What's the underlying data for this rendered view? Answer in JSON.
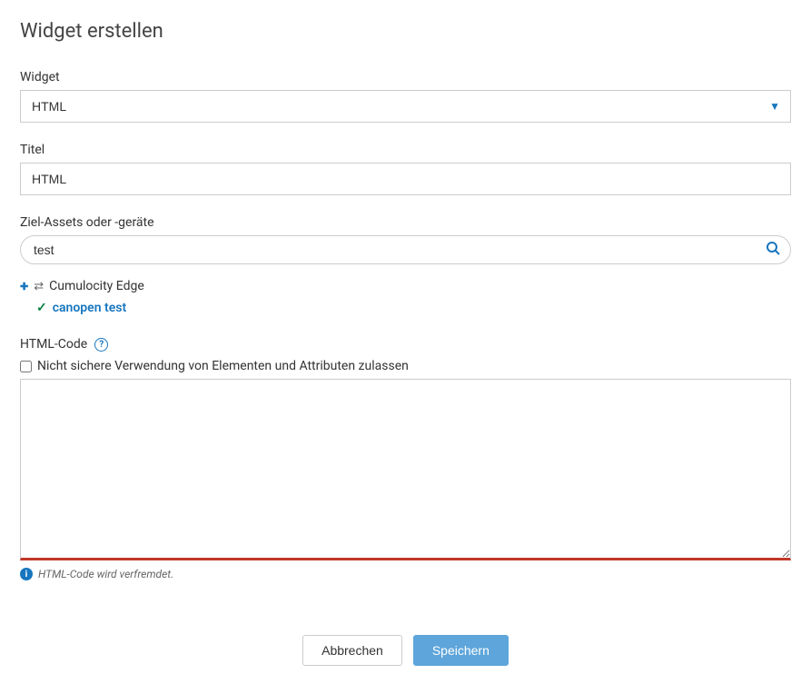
{
  "page": {
    "title": "Widget erstellen"
  },
  "form": {
    "widget": {
      "label": "Widget",
      "value": "HTML"
    },
    "title": {
      "label": "Titel",
      "value": "HTML"
    },
    "target": {
      "label": "Ziel-Assets oder -geräte",
      "search_value": "test",
      "tree": {
        "parent_label": "Cumulocity Edge",
        "child_label": "canopen test"
      }
    },
    "htmlcode": {
      "label": "HTML-Code",
      "checkbox_label": "Nicht sichere Verwendung von Elementen und Attributen zulassen",
      "checkbox_checked": false,
      "value": "",
      "hint": "HTML-Code wird verfremdet."
    }
  },
  "footer": {
    "cancel": "Abbrechen",
    "save": "Speichern"
  }
}
